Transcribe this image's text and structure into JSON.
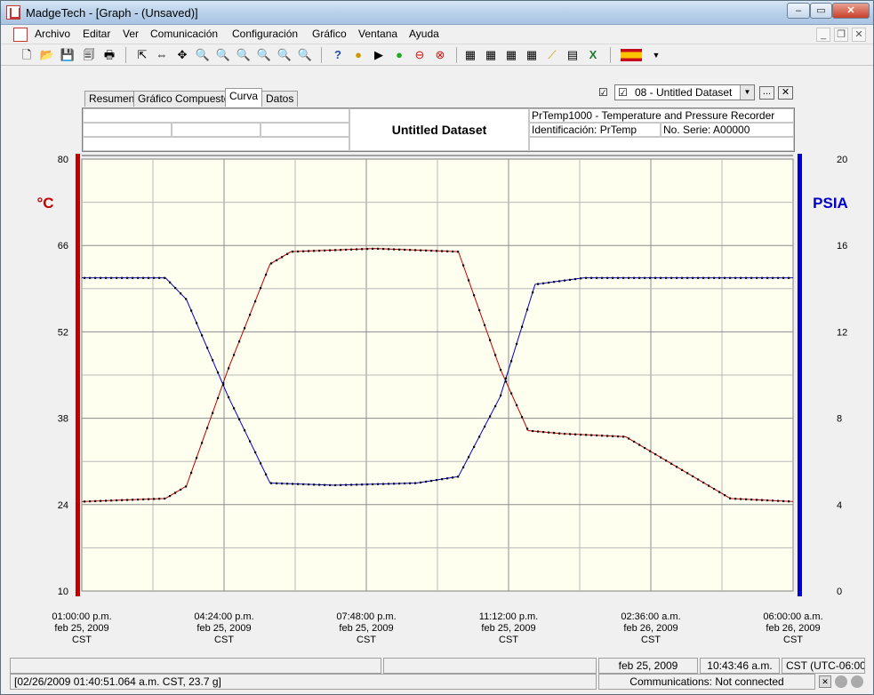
{
  "window": {
    "title": "MadgeTech - [Graph - (Unsaved)]"
  },
  "menu": [
    "Archivo",
    "Editar",
    "Ver",
    "Comunicación",
    "Configuración",
    "Gráfico",
    "Ventana",
    "Ayuda"
  ],
  "tabs": [
    "Resumen",
    "Gráfico Compuesto",
    "Curva",
    "Datos"
  ],
  "dataset_select": {
    "value": "08 - Untitled Dataset"
  },
  "header": {
    "title": "Untitled Dataset",
    "device": "PrTemp1000 - Temperature and Pressure Recorder",
    "ident": "Identificación: PrTemp",
    "serial": "No. Serie: A00000"
  },
  "colors": {
    "temp": "#c00000",
    "pressure": "#0000c8",
    "plot_bg": "#fffff0",
    "points": "#000000"
  },
  "chart_data": {
    "type": "line",
    "left_axis": {
      "label": "°C",
      "ticks": [
        "80",
        "66",
        "52",
        "38",
        "24",
        "10"
      ],
      "range": [
        10,
        80
      ]
    },
    "right_axis": {
      "label": "PSIA",
      "ticks": [
        "20",
        "16",
        "12",
        "8",
        "4",
        "0"
      ],
      "range": [
        0,
        20
      ]
    },
    "x_ticks": [
      {
        "time": "01:00:00 p.m.",
        "date": "feb 25, 2009",
        "tz": "CST"
      },
      {
        "time": "04:24:00 p.m.",
        "date": "feb 25, 2009",
        "tz": "CST"
      },
      {
        "time": "07:48:00 p.m.",
        "date": "feb 25, 2009",
        "tz": "CST"
      },
      {
        "time": "11:12:00 p.m.",
        "date": "feb 25, 2009",
        "tz": "CST"
      },
      {
        "time": "02:36:00 a.m.",
        "date": "feb 26, 2009",
        "tz": "CST"
      },
      {
        "time": "06:00:00 a.m.",
        "date": "feb 26, 2009",
        "tz": "CST"
      }
    ],
    "x_range": [
      "2009-02-25 13:00",
      "2009-02-26 06:00"
    ],
    "series": [
      {
        "axis": "left",
        "x": [
          "2009-02-25 13:00",
          "2009-02-25 15:00",
          "2009-02-25 15:30",
          "2009-02-25 16:30",
          "2009-02-25 17:30",
          "2009-02-25 18:00",
          "2009-02-25 20:00",
          "2009-02-25 22:00",
          "2009-02-25 23:00",
          "2009-02-25 23:40",
          "2009-02-26 00:30",
          "2009-02-26 02:00",
          "2009-02-26 03:00",
          "2009-02-26 04:30",
          "2009-02-26 06:00"
        ],
        "values": [
          24.5,
          25,
          27,
          46,
          63,
          65,
          65.5,
          65,
          46,
          36,
          35.5,
          35,
          31,
          25,
          24.5
        ]
      },
      {
        "axis": "right",
        "x": [
          "2009-02-25 13:00",
          "2009-02-25 15:00",
          "2009-02-25 15:30",
          "2009-02-25 16:30",
          "2009-02-25 17:30",
          "2009-02-25 19:00",
          "2009-02-25 21:00",
          "2009-02-25 22:00",
          "2009-02-25 23:00",
          "2009-02-25 23:50",
          "2009-02-26 01:00",
          "2009-02-26 06:00"
        ],
        "values": [
          14.5,
          14.5,
          13.5,
          9,
          5,
          4.9,
          5,
          5.3,
          9,
          14.2,
          14.5,
          14.5
        ]
      }
    ],
    "grid": true
  },
  "status": {
    "left": "",
    "date": "feb 25, 2009",
    "time": "10:43:46 a.m.",
    "tz": "CST (UTC-06:00)",
    "readout": "[02/26/2009 01:40:51.064 a.m. CST, 23.7 g]",
    "comm": "Communications: Not connected"
  }
}
